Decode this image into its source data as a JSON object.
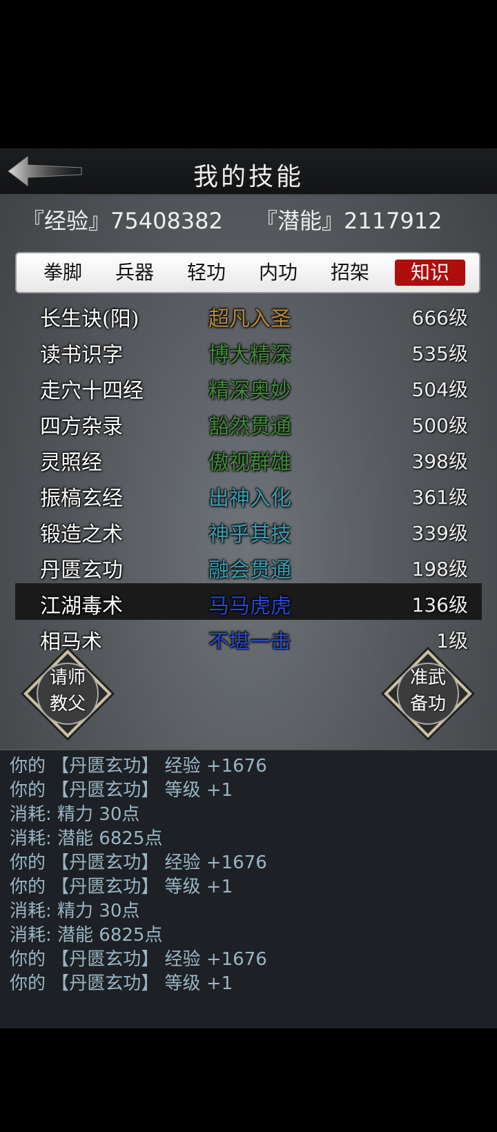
{
  "header": {
    "title": "我的技能"
  },
  "stats": {
    "exp": "『经验』75408382",
    "potential": "『潜能』2117912"
  },
  "tabs": [
    "拳脚",
    "兵器",
    "轻功",
    "内功",
    "招架",
    "知识"
  ],
  "active_tab": "知识",
  "skills": [
    {
      "name": "长生诀(阳)",
      "rank": "超凡入圣",
      "level": "666级",
      "rank_color": "#b8893a"
    },
    {
      "name": "读书识字",
      "rank": "博大精深",
      "level": "535级",
      "rank_color": "#3f8a36"
    },
    {
      "name": "走穴十四经",
      "rank": "精深奥妙",
      "level": "504级",
      "rank_color": "#3f8a36"
    },
    {
      "name": "四方杂录",
      "rank": "豁然贯通",
      "level": "500级",
      "rank_color": "#3f8a36"
    },
    {
      "name": "灵照经",
      "rank": "傲视群雄",
      "level": "398级",
      "rank_color": "#3f8a36"
    },
    {
      "name": "振槁玄经",
      "rank": "出神入化",
      "level": "361级",
      "rank_color": "#3a9bb0"
    },
    {
      "name": "锻造之术",
      "rank": "神乎其技",
      "level": "339级",
      "rank_color": "#3a9bb0"
    },
    {
      "name": "丹匮玄功",
      "rank": "融会贯通",
      "level": "198级",
      "rank_color": "#3a9bb0"
    },
    {
      "name": "江湖毒术",
      "rank": "马马虎虎",
      "level": "136级",
      "rank_color": "#2848c8"
    },
    {
      "name": "相马术",
      "rank": "不堪一击",
      "level": "1级",
      "rank_color": "#2848c8"
    }
  ],
  "selected_skill": "江湖毒术",
  "buttons": {
    "teacher": "请师\n教父",
    "prepare": "准武\n备功"
  },
  "log": [
    "你的 【丹匮玄功】 经验 +1676",
    "你的 【丹匮玄功】 等级 +1",
    "消耗: 精力 30点",
    "消耗: 潜能 6825点",
    "你的 【丹匮玄功】 经验 +1676",
    "你的 【丹匮玄功】 等级 +1",
    "消耗: 精力 30点",
    "消耗: 潜能 6825点",
    "你的 【丹匮玄功】 经验 +1676",
    "你的 【丹匮玄功】 等级 +1"
  ]
}
